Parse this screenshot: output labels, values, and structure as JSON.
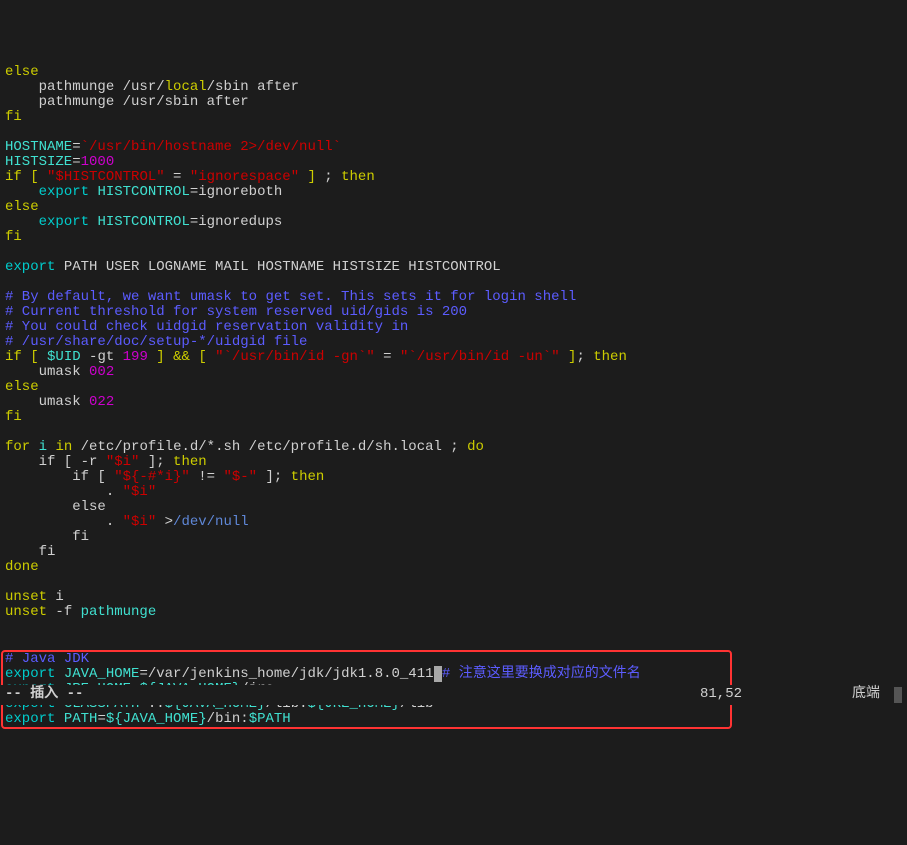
{
  "code": {
    "kw": {
      "else": "else",
      "fi": "fi",
      "if": "if",
      "bracket_open": "[",
      "bracket_close": "]",
      "then": "then",
      "export": "export",
      "for": "for",
      "do": "do",
      "in": "in",
      "done": "done",
      "and": "&&",
      "unset": "unset"
    },
    "tok": {
      "pathmunge1": "    pathmunge /usr/",
      "local": "local",
      "sbin_after": "/sbin after",
      "pathmunge2": "    pathmunge /usr/sbin after",
      "hostname_var": "HOSTNAME",
      "equals": "=",
      "hostname_val": "`/usr/bin/hostname 2>/dev/null`",
      "histsize_var": "HISTSIZE",
      "histsize_val": "1000",
      "histcontrol_lit": "\"$HISTCONTROL\"",
      "equals_sp": " = ",
      "ignorespace": "\"ignorespace\"",
      "semi_then": " ; ",
      "histcontrol_var": "HISTCONTROL",
      "ignoreboth": "=ignoreboth",
      "ignoredups": "=ignoredups",
      "export_vars": " PATH USER LOGNAME MAIL HOSTNAME HISTSIZE HISTCONTROL",
      "comment1": "# By default, we want umask to get set. This sets it for login shell",
      "comment2": "# Current threshold for system reserved uid/gids is 200",
      "comment3": "# You could check uidgid reservation validity in",
      "comment4": "# /usr/share/doc/setup-*/uidgid file",
      "uid_var": "$UID",
      "gt": " -gt ",
      "num199": "199",
      "id_gn": "\"`/usr/bin/id -gn`\"",
      "id_un": "\"`/usr/bin/id -un`\"",
      "semi_then2": "; ",
      "umask": "    umask ",
      "num002": "002",
      "num022": "022",
      "i_var": "i",
      "for_path": " /etc/profile.d/*.sh /etc/profile.d/sh.local ; ",
      "if_r": "    if [ -r ",
      "i_quoted": "\"$i\"",
      "bracket_semi": " ]; ",
      "if_inner": "        if [ ",
      "hash_star_i": "\"${-#*i}\"",
      "ne": " != ",
      "dash_dollar": "\"$-\"",
      "dot_sp": "            . ",
      "else_inner": "        else",
      "redirect": " >",
      "devnull": "/dev/null",
      "fi_inner": "        fi",
      "fi_mid": "    fi",
      "unset_i": " i",
      "unset_f": " -f ",
      "pathmunge_name": "pathmunge",
      "java_comment": "# Java JDK",
      "java_home_var": "JAVA_HOME",
      "java_home_val": "=/var/jenkins_home/jdk/jdk1.8.0_411",
      "java_comment2": "# 注意这里要换成对应的文件名",
      "jre_home_var": "JRE_HOME",
      "jre_home_val1": "=",
      "java_home_exp": "${JAVA_HOME}",
      "jre_suffix": "/jre",
      "classpath_var": "CLASSPATH",
      "classpath_val": "=.:",
      "classpath_mid": "/lib:",
      "jre_home_exp": "${JRE_HOME}",
      "classpath_end": "/lib",
      "path_var": "PATH",
      "path_val": "=",
      "path_mid": "/bin:",
      "path_end": "$PATH"
    }
  },
  "status": {
    "mode": "-- 插入 --",
    "position": "81,52",
    "scroll": "底端"
  }
}
